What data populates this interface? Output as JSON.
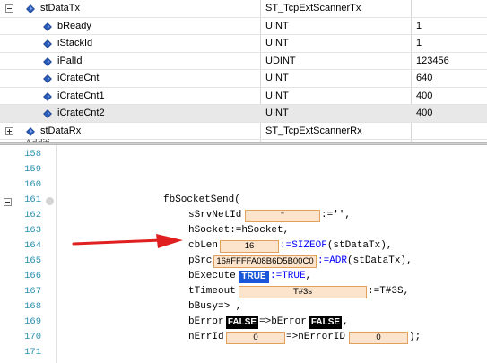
{
  "watch": {
    "rows": [
      {
        "name": "stDataTx",
        "type": "ST_TcpExtScannerTx",
        "value": ""
      },
      {
        "name": "bReady",
        "type": "UINT",
        "value": "1"
      },
      {
        "name": "iStackId",
        "type": "UINT",
        "value": "1"
      },
      {
        "name": "iPalId",
        "type": "UDINT",
        "value": "123456"
      },
      {
        "name": "iCrateCnt",
        "type": "UINT",
        "value": "640"
      },
      {
        "name": "iCrateCnt1",
        "type": "UINT",
        "value": "400"
      },
      {
        "name": "iCrateCnt2",
        "type": "UINT",
        "value": "400"
      },
      {
        "name": "stDataRx",
        "type": "ST_TcpExtScannerRx",
        "value": ""
      }
    ],
    "cut_text": "Additi"
  },
  "editor": {
    "line_numbers": [
      "158",
      "159",
      "160",
      "161",
      "162",
      "163",
      "164",
      "165",
      "166",
      "167",
      "168",
      "169",
      "170",
      "171"
    ],
    "call": "fbSocketSend(",
    "sSrvNetId": {
      "name": "sSrvNetId",
      "value": "''",
      "rest": ":=''",
      "suffix": ","
    },
    "hSocket": {
      "text": "hSocket:=hSocket,"
    },
    "cbLen": {
      "name": "cbLen",
      "value": "16",
      "rest_kw": ":=SIZEOF",
      "rest": "(stDataTx),"
    },
    "pSrc": {
      "name": "pSrc",
      "value": "16#FFFFA08B6D5B00C0",
      "rest_kw": ":=ADR",
      "rest": "(stDataTx),"
    },
    "bExecute": {
      "name": "bExecute",
      "value": "TRUE",
      "rest_kw": ":=TRUE",
      "rest": ","
    },
    "tTimeout": {
      "name": "tTimeout",
      "value": "T#3s",
      "rest": ":=T#3S,"
    },
    "bBusy": {
      "text": "bBusy=> ,"
    },
    "bError": {
      "name": "bError",
      "value": "FALSE",
      "mid": "=>bError",
      "value2": "FALSE",
      "suffix": ","
    },
    "nErrId": {
      "name": "nErrId",
      "value": "0",
      "mid": "=>nErrorID",
      "value2": "0",
      "suffix": ");"
    }
  },
  "colors": {
    "line_number": "#2b91af",
    "keyword": "#0000ff",
    "inline_value_bg": "#fbe3cc",
    "inline_value_border": "#e1a05b",
    "true_badge": "#1a57d8",
    "false_badge": "#000000",
    "arrow": "#e02020"
  }
}
